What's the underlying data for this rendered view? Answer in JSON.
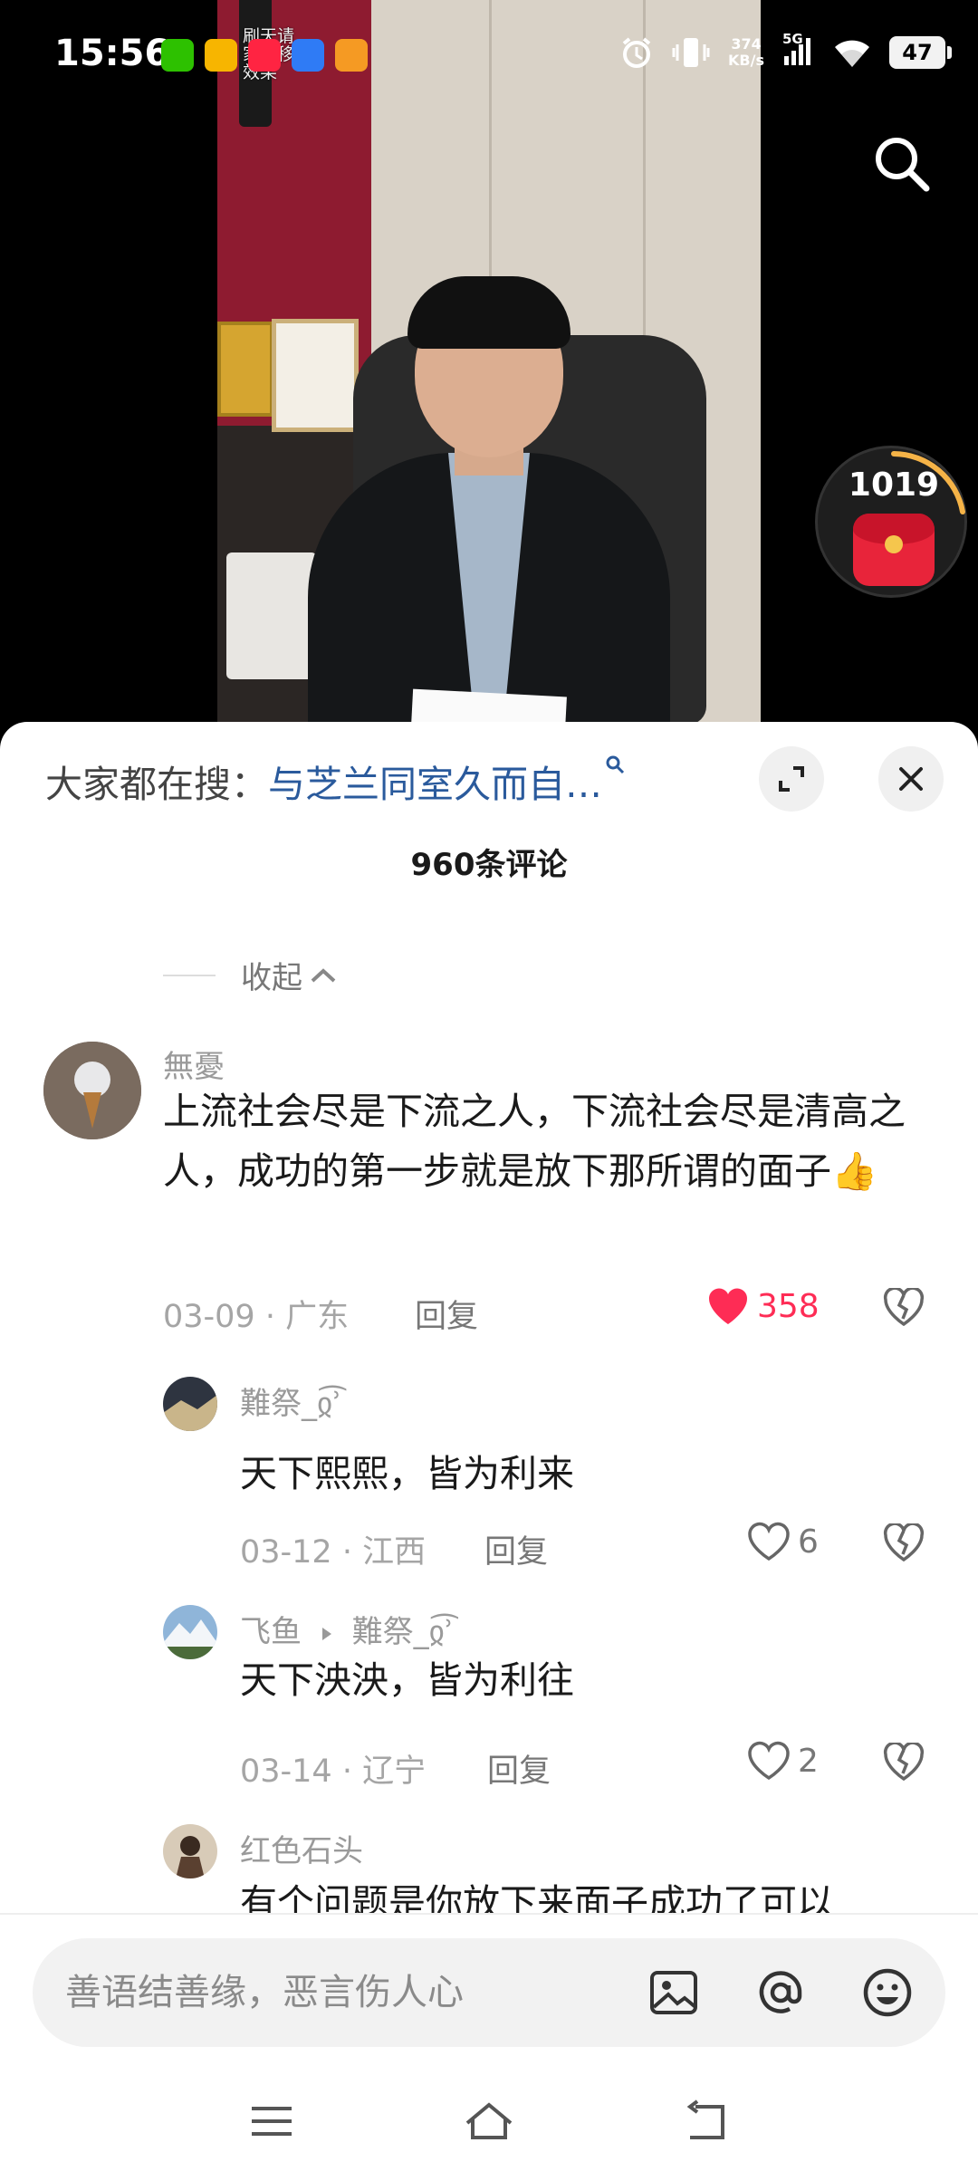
{
  "status_bar": {
    "time": "15:56",
    "net_speed_value": "374",
    "net_speed_unit": "KB/s",
    "network": "5G",
    "battery": "47"
  },
  "video": {
    "overlay_text": "刷天请 家转移 效果",
    "red_packet_count": "1019"
  },
  "comments_panel": {
    "hot_search_prefix": "大家都在搜：",
    "hot_search_term": "与芝兰同室久而自…",
    "comment_count": "960条评论",
    "collapse_label": "收起",
    "comments": [
      {
        "user": "無憂",
        "text": "上流社会尽是下流之人，下流社会尽是清高之人，成功的第一步就是放下那所谓的面子👍",
        "date_loc": "03-09 · 广东",
        "reply_label": "回复",
        "likes": "358"
      },
      {
        "user": "難祭_ჲ͡ʾ",
        "text": "天下熙熙，皆为利来",
        "date_loc": "03-12 · 江西",
        "reply_label": "回复",
        "likes": "6"
      },
      {
        "user": "飞鱼",
        "reply_to": "難祭_ჲ͡ʾ",
        "text": "天下泱泱，皆为利往",
        "date_loc": "03-14 · 辽宁",
        "reply_label": "回复",
        "likes": "2"
      },
      {
        "user": "红色石头",
        "text": "有个问题是你放下来面子成功了可以"
      }
    ]
  },
  "input_bar": {
    "placeholder": "善语结善缘，恶言伤人心"
  },
  "colors": {
    "accent_red": "#fe2c55",
    "link_blue": "#2a5a9c"
  }
}
